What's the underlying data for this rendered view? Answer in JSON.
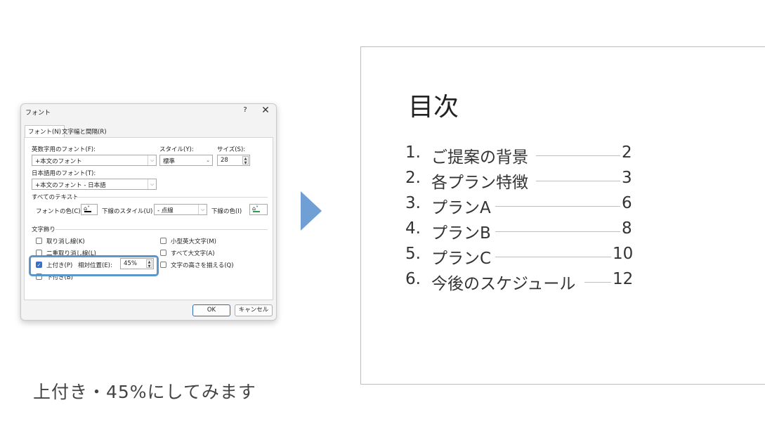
{
  "dialog": {
    "title": "フォント",
    "help": "?",
    "close": "✕",
    "tabs": [
      "フォント(N)",
      "文字幅と間隔(R)"
    ],
    "latin_font_label": "英数字用のフォント(F):",
    "latin_font_value": "+本文のフォント",
    "style_label": "スタイル(Y):",
    "style_value": "標準",
    "size_label": "サイズ(S):",
    "size_value": "28",
    "asian_font_label": "日本語用のフォント(T):",
    "asian_font_value": "+本文のフォント - 日本語",
    "all_text_label": "すべてのテキスト",
    "font_color_label": "フォントの色(C)",
    "underline_style_label": "下線のスタイル(U)",
    "underline_style_value": "- 点線",
    "underline_color_label": "下線の色(I)",
    "effects_label": "文字飾り",
    "effects": {
      "strikethrough": "取り消し線(K)",
      "double_strikethrough": "二重取り消し線(L)",
      "superscript": "上付き(P)",
      "subscript": "下付き(B)",
      "small_caps": "小型英大文字(M)",
      "all_caps": "すべて大文字(A)",
      "equalize_height": "文字の高さを揃える(Q)"
    },
    "offset_label": "相対位置(E):",
    "offset_value": "45%",
    "ok": "OK",
    "cancel": "キャンセル",
    "colors": {
      "font_color_line": "#000000",
      "underline_color_line": "#2e9e4a",
      "accent": "#3b6fc2"
    }
  },
  "caption": "上付き・45%にしてみます",
  "slide": {
    "title": "目次",
    "toc": [
      {
        "num": "1.",
        "text": "ご提案の背景",
        "page": "2"
      },
      {
        "num": "2.",
        "text": "各プラン特徴",
        "page": "3"
      },
      {
        "num": "3.",
        "text": "プランA",
        "page": "6"
      },
      {
        "num": "4.",
        "text": "プランB",
        "page": "8"
      },
      {
        "num": "5.",
        "text": "プランC",
        "page": "10"
      },
      {
        "num": "6.",
        "text": "今後のスケジュール",
        "page": "12"
      }
    ]
  },
  "colors": {
    "arrow": "#6f9fd4",
    "highlight": "#5c97cc",
    "leader": "#9dcfc7"
  }
}
